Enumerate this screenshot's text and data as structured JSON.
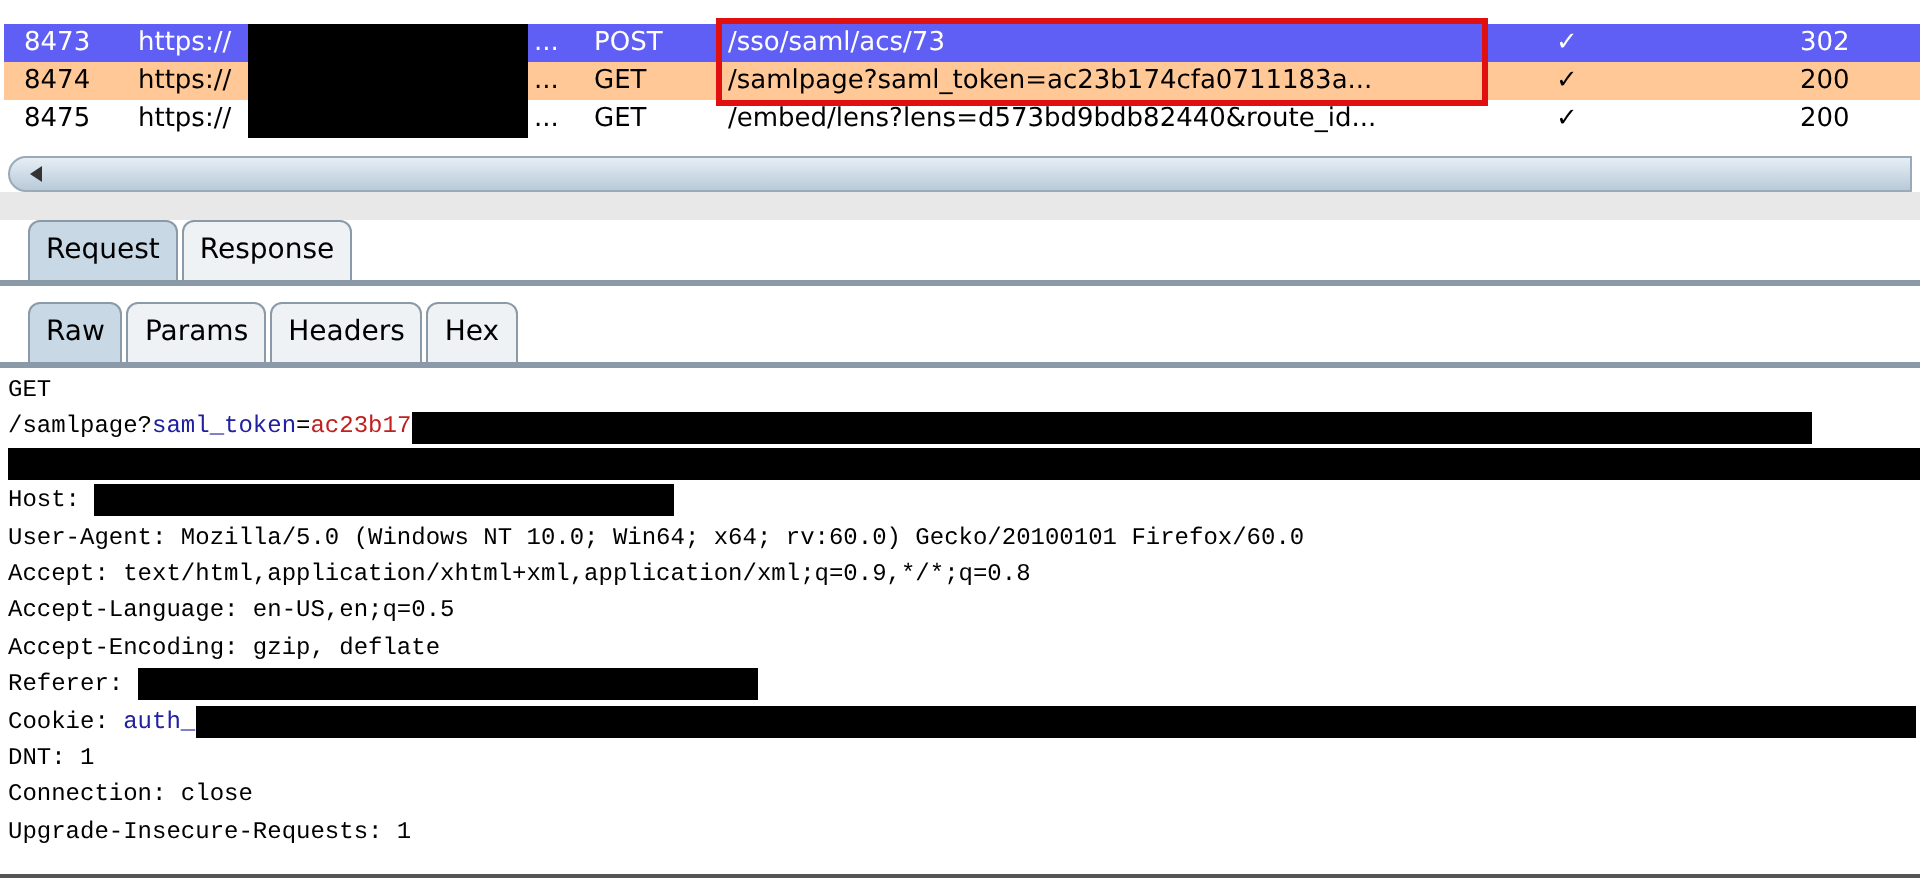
{
  "requests": [
    {
      "number": "8473",
      "host": "https://",
      "host_tail": "...",
      "method": "POST",
      "url": "/sso/saml/acs/73",
      "check": "✓",
      "status": "302",
      "selected": true
    },
    {
      "number": "8474",
      "host": "https://",
      "host_tail": "...",
      "method": "GET",
      "url": "/samlpage?saml_token=ac23b174cfa0711183a...",
      "check": "✓",
      "status": "200",
      "selected": false,
      "color": "#ffc896"
    },
    {
      "number": "8475",
      "host": "https://",
      "host_tail": "...",
      "method": "GET",
      "url": "/embed/lens?lens=d573bd9bdb82440&route_id...",
      "check": "✓",
      "status": "200",
      "selected": false
    }
  ],
  "message_tabs": [
    {
      "label": "Request",
      "selected": true
    },
    {
      "label": "Response",
      "selected": false
    }
  ],
  "view_tabs": [
    {
      "label": "Raw",
      "selected": true
    },
    {
      "label": "Params",
      "selected": false
    },
    {
      "label": "Headers",
      "selected": false
    },
    {
      "label": "Hex",
      "selected": false
    }
  ],
  "request_lines": [
    {
      "parts": [
        {
          "kind": "plain",
          "text": "GET"
        }
      ],
      "redacted": false
    },
    {
      "parts": [
        {
          "kind": "plain",
          "text": "/samlpage?"
        },
        {
          "kind": "name",
          "text": "saml_token"
        },
        {
          "kind": "plain",
          "text": "="
        },
        {
          "kind": "value",
          "text": "ac23b17"
        }
      ],
      "redacted": true
    },
    {
      "redacted": true
    },
    {
      "parts": [
        {
          "kind": "plain",
          "text": "Host: "
        }
      ],
      "redacted": true
    },
    {
      "parts": [
        {
          "kind": "plain",
          "text": "User-Agent: Mozilla/5.0 (Windows NT 10.0; Win64; x64; rv:60.0) Gecko/20100101 Firefox/60.0"
        }
      ],
      "redacted": false
    },
    {
      "parts": [
        {
          "kind": "plain",
          "text": "Accept: text/html,application/xhtml+xml,application/xml;q=0.9,*/*;q=0.8"
        }
      ],
      "redacted": false
    },
    {
      "parts": [
        {
          "kind": "plain",
          "text": "Accept-Language: en-US,en;q=0.5"
        }
      ],
      "redacted": false
    },
    {
      "parts": [
        {
          "kind": "plain",
          "text": "Accept-Encoding: gzip, deflate"
        }
      ],
      "redacted": false
    },
    {
      "parts": [
        {
          "kind": "plain",
          "text": "Referer: "
        }
      ],
      "redacted": true
    },
    {
      "parts": [
        {
          "kind": "plain",
          "text": "Cookie: "
        },
        {
          "kind": "name",
          "text": "auth_"
        }
      ],
      "redacted": true
    },
    {
      "parts": [
        {
          "kind": "plain",
          "text": "DNT: 1"
        }
      ],
      "redacted": false
    },
    {
      "parts": [
        {
          "kind": "plain",
          "text": "Connection: close"
        }
      ],
      "redacted": false
    },
    {
      "parts": [
        {
          "kind": "plain",
          "text": "Upgrade-Insecure-Requests: 1"
        }
      ],
      "redacted": false
    }
  ]
}
